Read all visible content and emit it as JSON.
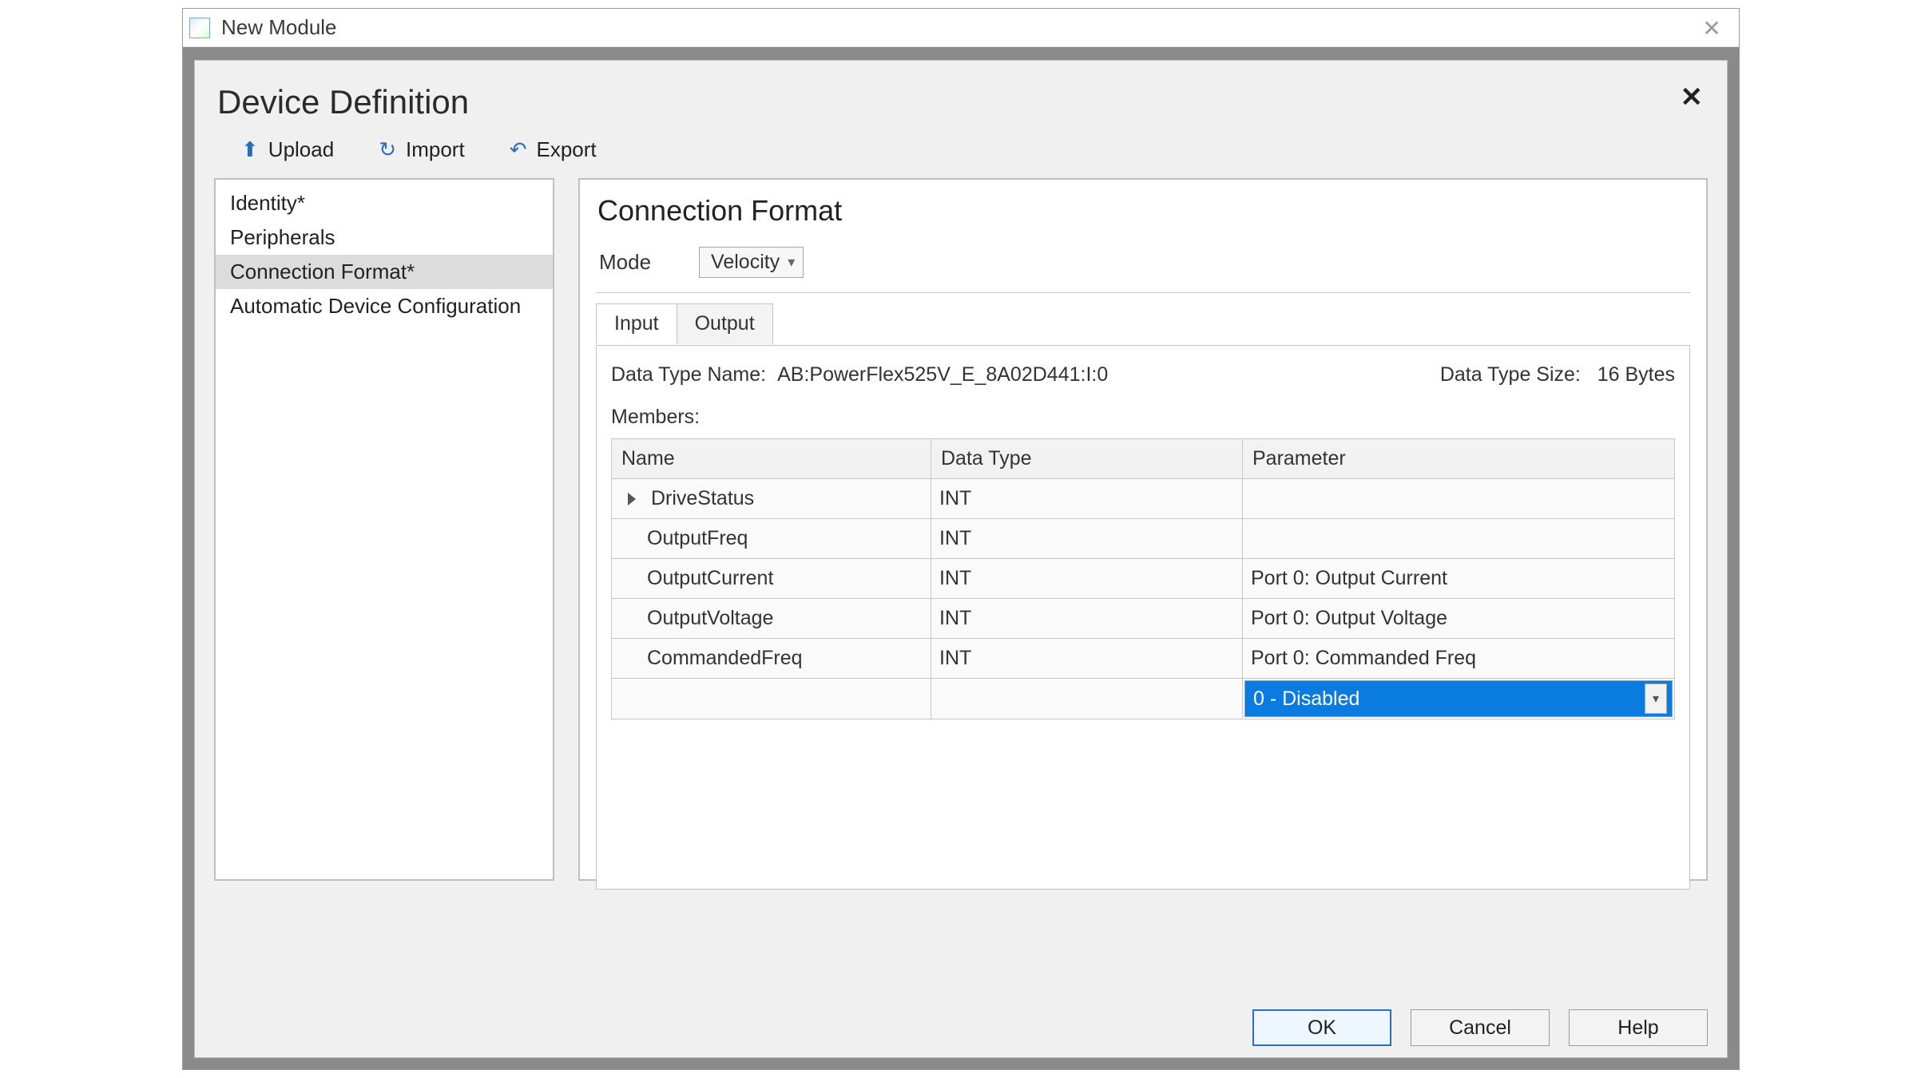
{
  "window": {
    "title": "New Module"
  },
  "panel": {
    "title": "Device Definition"
  },
  "toolbar": {
    "upload": "Upload",
    "import": "Import",
    "export": "Export"
  },
  "nav": {
    "items": [
      "Identity*",
      "Peripherals",
      "Connection Format*",
      "Automatic Device Configuration"
    ],
    "selected_index": 2
  },
  "main": {
    "section_title": "Connection Format",
    "mode_label": "Mode",
    "mode_value": "Velocity",
    "tabs": [
      {
        "label": "Input"
      },
      {
        "label": "Output"
      }
    ],
    "active_tab": 0,
    "data_type_name_label": "Data Type Name:",
    "data_type_name_value": "AB:PowerFlex525V_E_8A02D441:I:0",
    "data_type_size_label": "Data Type Size:",
    "data_type_size_value": "16 Bytes",
    "members_label": "Members:",
    "columns": {
      "name": "Name",
      "datatype": "Data Type",
      "parameter": "Parameter"
    },
    "rows": [
      {
        "name": "DriveStatus",
        "datatype": "INT",
        "parameter": "",
        "expandable": true
      },
      {
        "name": "OutputFreq",
        "datatype": "INT",
        "parameter": "",
        "expandable": false
      },
      {
        "name": "OutputCurrent",
        "datatype": "INT",
        "parameter": "Port 0: Output Current",
        "expandable": false
      },
      {
        "name": "OutputVoltage",
        "datatype": "INT",
        "parameter": "Port 0: Output Voltage",
        "expandable": false
      },
      {
        "name": "CommandedFreq",
        "datatype": "INT",
        "parameter": "Port 0: Commanded Freq",
        "expandable": false
      }
    ],
    "new_row_parameter_value": "0 - Disabled"
  },
  "footer": {
    "ok": "OK",
    "cancel": "Cancel",
    "help": "Help"
  }
}
